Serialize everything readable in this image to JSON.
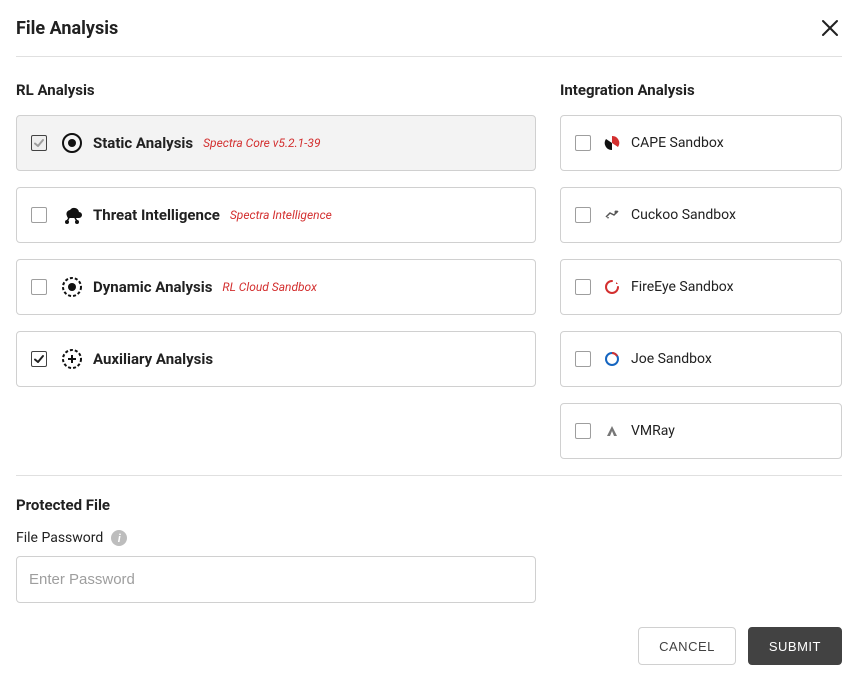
{
  "modal": {
    "title": "File Analysis"
  },
  "rl": {
    "heading": "RL Analysis",
    "items": [
      {
        "label": "Static Analysis",
        "sub": "Spectra Core v5.2.1-39",
        "checked": true,
        "disabled": true,
        "icon": "target-icon"
      },
      {
        "label": "Threat Intelligence",
        "sub": "Spectra Intelligence",
        "checked": false,
        "disabled": false,
        "icon": "cloud-nodes-icon"
      },
      {
        "label": "Dynamic Analysis",
        "sub": "RL Cloud Sandbox",
        "checked": false,
        "disabled": false,
        "icon": "dotted-target-icon"
      },
      {
        "label": "Auxiliary Analysis",
        "sub": "",
        "checked": true,
        "disabled": false,
        "icon": "crosshair-plus-icon"
      }
    ]
  },
  "integration": {
    "heading": "Integration Analysis",
    "items": [
      {
        "label": "CAPE Sandbox",
        "icon": "cape-icon",
        "checked": false
      },
      {
        "label": "Cuckoo Sandbox",
        "icon": "cuckoo-icon",
        "checked": false
      },
      {
        "label": "FireEye Sandbox",
        "icon": "fireeye-icon",
        "checked": false
      },
      {
        "label": "Joe Sandbox",
        "icon": "joe-icon",
        "checked": false
      },
      {
        "label": "VMRay",
        "icon": "vmray-icon",
        "checked": false
      }
    ]
  },
  "protected": {
    "heading": "Protected File",
    "password_label": "File Password",
    "placeholder": "Enter Password",
    "value": ""
  },
  "footer": {
    "cancel": "CANCEL",
    "submit": "SUBMIT"
  },
  "colors": {
    "accent_red": "#d32f2f",
    "border_gray": "#d0d0d0",
    "btn_dark": "#424242"
  }
}
